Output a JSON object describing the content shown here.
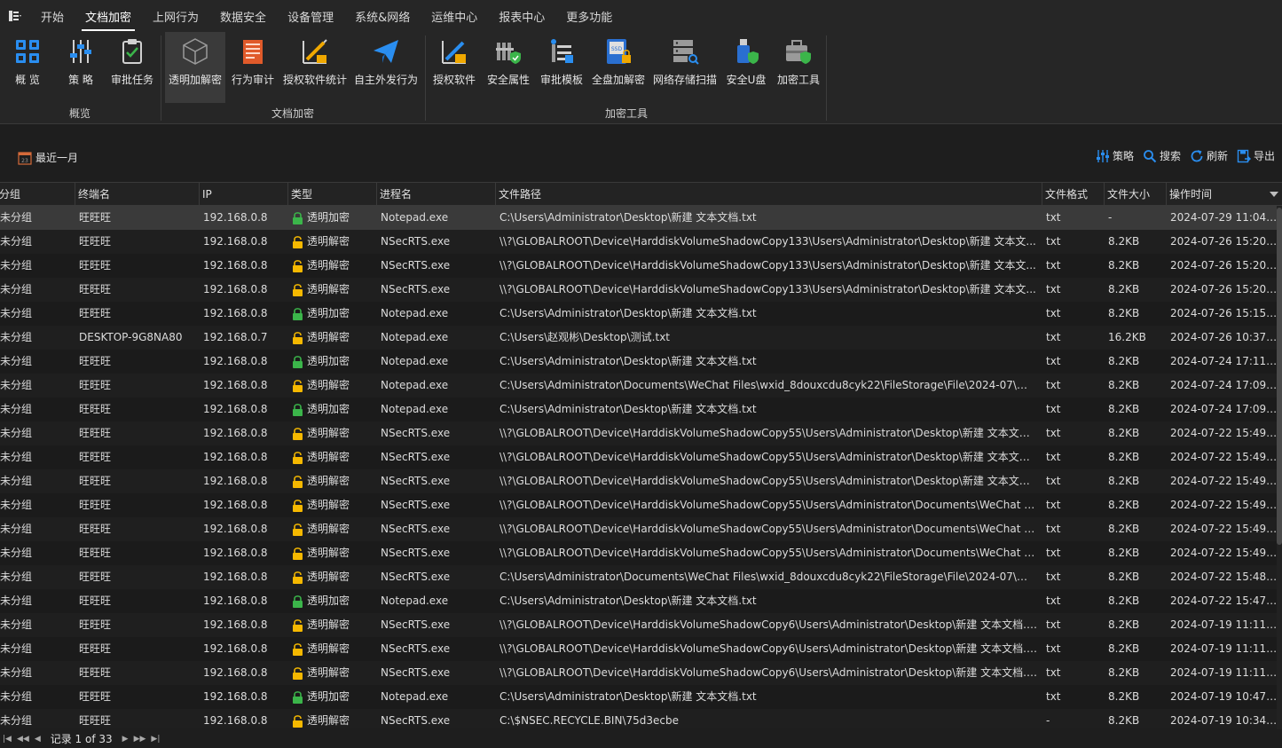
{
  "menubar": {
    "app_menu_icon": "menu-grid-icon",
    "tabs": [
      "开始",
      "文档加密",
      "上网行为",
      "数据安全",
      "设备管理",
      "系统&网络",
      "运维中心",
      "报表中心",
      "更多功能"
    ],
    "active_tab": "文档加密"
  },
  "ribbon": {
    "groups": [
      {
        "label": "概览",
        "buttons": [
          {
            "label": "概 览",
            "icon": "overview-grid-icon"
          },
          {
            "label": "策 略",
            "icon": "policy-sliders-icon"
          },
          {
            "label": "审批任务",
            "icon": "clipboard-check-icon"
          }
        ]
      },
      {
        "label": "文档加密",
        "buttons": [
          {
            "label": "透明加解密",
            "icon": "cube-icon",
            "selected": true
          },
          {
            "label": "行为审计",
            "icon": "audit-document-icon"
          },
          {
            "label": "授权软件统计",
            "icon": "chart-pen-icon"
          },
          {
            "label": "自主外发行为",
            "icon": "paper-plane-icon"
          }
        ]
      },
      {
        "label": "加密工具",
        "buttons": [
          {
            "label": "授权软件",
            "icon": "auth-software-icon"
          },
          {
            "label": "安全属性",
            "icon": "security-attribute-icon"
          },
          {
            "label": "审批模板",
            "icon": "approval-template-icon"
          },
          {
            "label": "全盘加解密",
            "icon": "ssd-lock-icon"
          },
          {
            "label": "网络存储扫描",
            "icon": "server-search-icon"
          },
          {
            "label": "安全U盘",
            "icon": "usb-shield-icon"
          },
          {
            "label": "加密工具",
            "icon": "toolbox-shield-icon"
          }
        ]
      }
    ]
  },
  "toolbar": {
    "date_filter": "最近一月",
    "date_icon": "calendar-icon",
    "actions": [
      {
        "label": "策略",
        "icon": "sliders-icon"
      },
      {
        "label": "搜索",
        "icon": "search-icon"
      },
      {
        "label": "刷新",
        "icon": "refresh-icon"
      },
      {
        "label": "导出",
        "icon": "export-icon"
      }
    ]
  },
  "grid": {
    "columns": [
      "分组",
      "终端名",
      "IP",
      "类型",
      "进程名",
      "文件路径",
      "文件格式",
      "文件大小",
      "操作时间"
    ],
    "sort_column": "操作时间",
    "sort_direction": "desc",
    "rows": [
      [
        "未分组",
        "旺旺旺",
        "192.168.0.8",
        "透明加密",
        "Notepad.exe",
        "C:\\Users\\Administrator\\Desktop\\新建 文本文档.txt",
        "txt",
        "-",
        "2024-07-29 11:04:55"
      ],
      [
        "未分组",
        "旺旺旺",
        "192.168.0.8",
        "透明解密",
        "NSecRTS.exe",
        "\\\\?\\GLOBALROOT\\Device\\HarddiskVolumeShadowCopy133\\Users\\Administrator\\Desktop\\新建 文本文...",
        "txt",
        "8.2KB",
        "2024-07-26 15:20:28"
      ],
      [
        "未分组",
        "旺旺旺",
        "192.168.0.8",
        "透明解密",
        "NSecRTS.exe",
        "\\\\?\\GLOBALROOT\\Device\\HarddiskVolumeShadowCopy133\\Users\\Administrator\\Desktop\\新建 文本文...",
        "txt",
        "8.2KB",
        "2024-07-26 15:20:28"
      ],
      [
        "未分组",
        "旺旺旺",
        "192.168.0.8",
        "透明解密",
        "NSecRTS.exe",
        "\\\\?\\GLOBALROOT\\Device\\HarddiskVolumeShadowCopy133\\Users\\Administrator\\Desktop\\新建 文本文...",
        "txt",
        "8.2KB",
        "2024-07-26 15:20:28"
      ],
      [
        "未分组",
        "旺旺旺",
        "192.168.0.8",
        "透明加密",
        "Notepad.exe",
        "C:\\Users\\Administrator\\Desktop\\新建 文本文档.txt",
        "txt",
        "8.2KB",
        "2024-07-26 15:15:11"
      ],
      [
        "未分组",
        "DESKTOP-9G8NA80",
        "192.168.0.7",
        "透明解密",
        "Notepad.exe",
        "C:\\Users\\赵观彬\\Desktop\\测试.txt",
        "txt",
        "16.2KB",
        "2024-07-26 10:37:32"
      ],
      [
        "未分组",
        "旺旺旺",
        "192.168.0.8",
        "透明加密",
        "Notepad.exe",
        "C:\\Users\\Administrator\\Desktop\\新建 文本文档.txt",
        "txt",
        "8.2KB",
        "2024-07-24 17:11:39"
      ],
      [
        "未分组",
        "旺旺旺",
        "192.168.0.8",
        "透明解密",
        "Notepad.exe",
        "C:\\Users\\Administrator\\Documents\\WeChat Files\\wxid_8douxcdu8cyk22\\FileStorage\\File\\2024-07\\新建 ...",
        "txt",
        "8.2KB",
        "2024-07-24 17:09:26"
      ],
      [
        "未分组",
        "旺旺旺",
        "192.168.0.8",
        "透明加密",
        "Notepad.exe",
        "C:\\Users\\Administrator\\Desktop\\新建 文本文档.txt",
        "txt",
        "8.2KB",
        "2024-07-24 17:09:24"
      ],
      [
        "未分组",
        "旺旺旺",
        "192.168.0.8",
        "透明解密",
        "NSecRTS.exe",
        "\\\\?\\GLOBALROOT\\Device\\HarddiskVolumeShadowCopy55\\Users\\Administrator\\Desktop\\新建 文本文档...",
        "txt",
        "8.2KB",
        "2024-07-22 15:49:03"
      ],
      [
        "未分组",
        "旺旺旺",
        "192.168.0.8",
        "透明解密",
        "NSecRTS.exe",
        "\\\\?\\GLOBALROOT\\Device\\HarddiskVolumeShadowCopy55\\Users\\Administrator\\Desktop\\新建 文本文档...",
        "txt",
        "8.2KB",
        "2024-07-22 15:49:03"
      ],
      [
        "未分组",
        "旺旺旺",
        "192.168.0.8",
        "透明解密",
        "NSecRTS.exe",
        "\\\\?\\GLOBALROOT\\Device\\HarddiskVolumeShadowCopy55\\Users\\Administrator\\Desktop\\新建 文本文档...",
        "txt",
        "8.2KB",
        "2024-07-22 15:49:03"
      ],
      [
        "未分组",
        "旺旺旺",
        "192.168.0.8",
        "透明解密",
        "NSecRTS.exe",
        "\\\\?\\GLOBALROOT\\Device\\HarddiskVolumeShadowCopy55\\Users\\Administrator\\Documents\\WeChat Fil...",
        "txt",
        "8.2KB",
        "2024-07-22 15:49:03"
      ],
      [
        "未分组",
        "旺旺旺",
        "192.168.0.8",
        "透明解密",
        "NSecRTS.exe",
        "\\\\?\\GLOBALROOT\\Device\\HarddiskVolumeShadowCopy55\\Users\\Administrator\\Documents\\WeChat Fil...",
        "txt",
        "8.2KB",
        "2024-07-22 15:49:03"
      ],
      [
        "未分组",
        "旺旺旺",
        "192.168.0.8",
        "透明解密",
        "NSecRTS.exe",
        "\\\\?\\GLOBALROOT\\Device\\HarddiskVolumeShadowCopy55\\Users\\Administrator\\Documents\\WeChat Fil...",
        "txt",
        "8.2KB",
        "2024-07-22 15:49:03"
      ],
      [
        "未分组",
        "旺旺旺",
        "192.168.0.8",
        "透明解密",
        "NSecRTS.exe",
        "C:\\Users\\Administrator\\Documents\\WeChat Files\\wxid_8douxcdu8cyk22\\FileStorage\\File\\2024-07\\新建 ...",
        "txt",
        "8.2KB",
        "2024-07-22 15:48:05"
      ],
      [
        "未分组",
        "旺旺旺",
        "192.168.0.8",
        "透明加密",
        "Notepad.exe",
        "C:\\Users\\Administrator\\Desktop\\新建 文本文档.txt",
        "txt",
        "8.2KB",
        "2024-07-22 15:47:18"
      ],
      [
        "未分组",
        "旺旺旺",
        "192.168.0.8",
        "透明解密",
        "NSecRTS.exe",
        "\\\\?\\GLOBALROOT\\Device\\HarddiskVolumeShadowCopy6\\Users\\Administrator\\Desktop\\新建 文本文档.txt",
        "txt",
        "8.2KB",
        "2024-07-19 11:11:40"
      ],
      [
        "未分组",
        "旺旺旺",
        "192.168.0.8",
        "透明解密",
        "NSecRTS.exe",
        "\\\\?\\GLOBALROOT\\Device\\HarddiskVolumeShadowCopy6\\Users\\Administrator\\Desktop\\新建 文本文档.txt",
        "txt",
        "8.2KB",
        "2024-07-19 11:11:40"
      ],
      [
        "未分组",
        "旺旺旺",
        "192.168.0.8",
        "透明解密",
        "NSecRTS.exe",
        "\\\\?\\GLOBALROOT\\Device\\HarddiskVolumeShadowCopy6\\Users\\Administrator\\Desktop\\新建 文本文档.txt",
        "txt",
        "8.2KB",
        "2024-07-19 11:11:40"
      ],
      [
        "未分组",
        "旺旺旺",
        "192.168.0.8",
        "透明加密",
        "Notepad.exe",
        "C:\\Users\\Administrator\\Desktop\\新建 文本文档.txt",
        "txt",
        "8.2KB",
        "2024-07-19 10:47:29"
      ],
      [
        "未分组",
        "旺旺旺",
        "192.168.0.8",
        "透明解密",
        "NSecRTS.exe",
        "C:\\$NSEC.RECYCLE.BIN\\75d3ecbe",
        "-",
        "8.2KB",
        "2024-07-19 10:34:39"
      ]
    ],
    "selected_row": 0
  },
  "navigator": {
    "record_text": "记录 1 of 33",
    "buttons": [
      "first-page-icon",
      "prev-page-icon",
      "prev-icon",
      "next-icon",
      "next-page-icon",
      "last-page-icon"
    ]
  },
  "colors": {
    "encrypt_lock": "#3bb54a",
    "decrypt_lock": "#f5b800",
    "accent_blue": "#2a8ef0",
    "background": "#1e1e1e"
  }
}
